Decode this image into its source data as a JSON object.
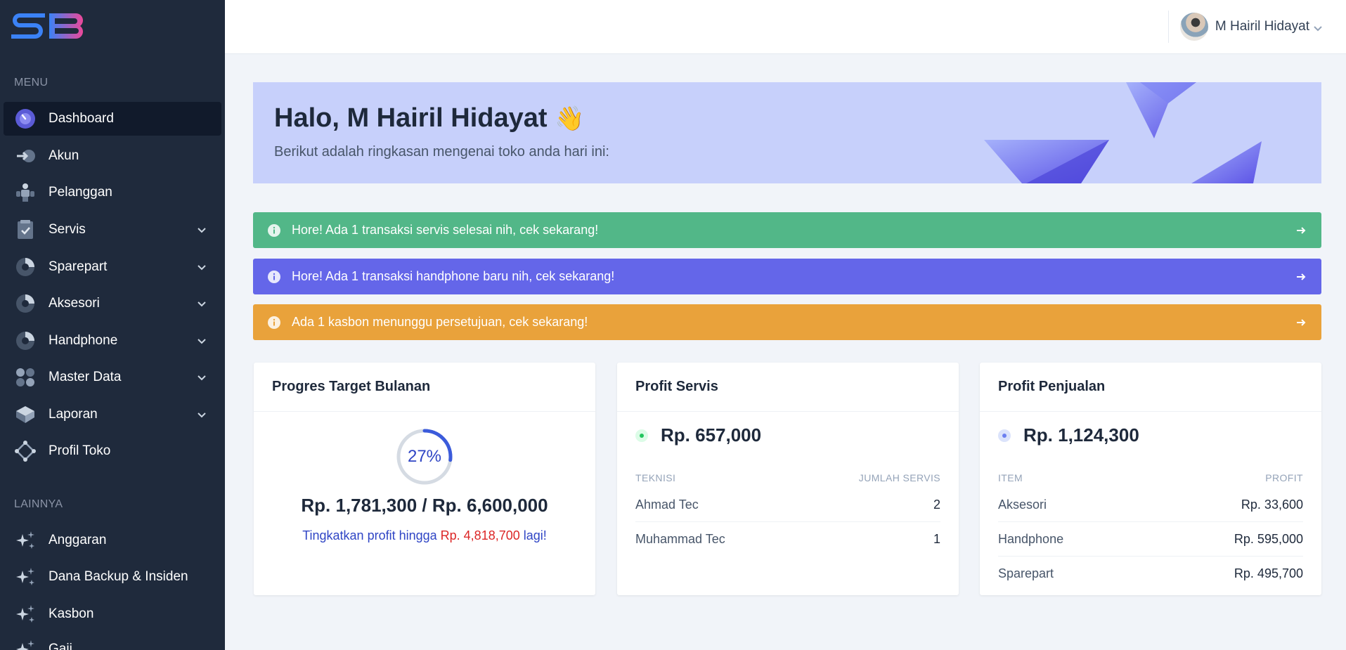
{
  "sidebar": {
    "menu_title": "MENU",
    "other_title": "LAINNYA",
    "items": [
      {
        "label": "Dashboard",
        "icon": "dashboard-icon"
      },
      {
        "label": "Akun",
        "icon": "login-arrow-icon"
      },
      {
        "label": "Pelanggan",
        "icon": "people-icon"
      },
      {
        "label": "Servis",
        "icon": "clipboard-check-icon"
      },
      {
        "label": "Sparepart",
        "icon": "pie-icon"
      },
      {
        "label": "Aksesori",
        "icon": "pie-icon"
      },
      {
        "label": "Handphone",
        "icon": "pie-icon"
      },
      {
        "label": "Master Data",
        "icon": "grid-dots-icon"
      },
      {
        "label": "Laporan",
        "icon": "layers-icon"
      },
      {
        "label": "Profil Toko",
        "icon": "diamond-nodes-icon"
      }
    ],
    "other_items": [
      {
        "label": "Anggaran",
        "icon": "sparkles-icon"
      },
      {
        "label": "Dana Backup & Insiden",
        "icon": "sparkles-icon"
      },
      {
        "label": "Kasbon",
        "icon": "sparkles-icon"
      },
      {
        "label": "Gaji",
        "icon": "sparkles-icon"
      }
    ]
  },
  "header": {
    "user_name": "M Hairil Hidayat"
  },
  "banner": {
    "greeting": "Halo, M Hairil Hidayat",
    "emoji": "👋",
    "subtitle": "Berikut adalah ringkasan mengenai toko anda hari ini:"
  },
  "alerts": [
    {
      "text": "Hore! Ada 1 transaksi servis selesai nih, cek sekarang!",
      "color": "#52b788"
    },
    {
      "text": "Hore! Ada 1 transaksi handphone baru nih, cek sekarang!",
      "color": "#6466e9"
    },
    {
      "text": "Ada 1 kasbon menunggu persetujuan, cek sekarang!",
      "color": "#e9a23b"
    }
  ],
  "target": {
    "title": "Progres Target Bulanan",
    "percent_label": "27%",
    "progress": 0.27,
    "amounts": "Rp. 1,781,300 / Rp. 6,600,000",
    "cta_prefix": "Tingkatkan profit hingga",
    "cta_amount": "Rp. 4,818,700",
    "cta_suffix": "lagi!"
  },
  "profit_servis": {
    "title": "Profit Servis",
    "amount": "Rp. 657,000",
    "col_left": "TEKNISI",
    "col_right": "JUMLAH SERVIS",
    "rows": [
      {
        "name": "Ahmad Tec",
        "value": "2"
      },
      {
        "name": "Muhammad Tec",
        "value": "1"
      }
    ]
  },
  "profit_penjualan": {
    "title": "Profit Penjualan",
    "amount": "Rp. 1,124,300",
    "col_left": "ITEM",
    "col_right": "PROFIT",
    "rows": [
      {
        "name": "Aksesori",
        "value": "Rp. 33,600"
      },
      {
        "name": "Handphone",
        "value": "Rp. 595,000"
      },
      {
        "name": "Sparepart",
        "value": "Rp. 495,700"
      }
    ]
  },
  "colors": {
    "sidebar": "#1f2a3c",
    "accent": "#4f46e5",
    "danger": "#dc2626",
    "link": "#2f45c5",
    "green_dot": "#22c55e",
    "blue_dot": "#6b7ff0"
  }
}
